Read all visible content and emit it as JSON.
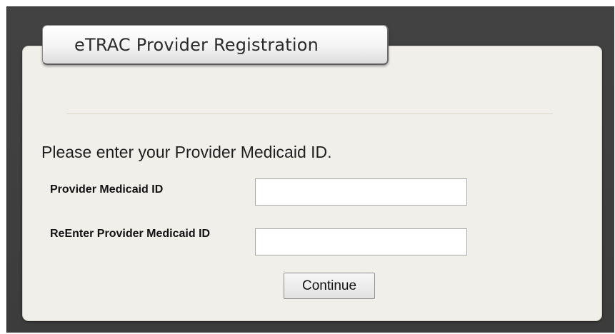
{
  "form": {
    "title": "eTRAC Provider Registration",
    "instruction": "Please enter your Provider Medicaid ID.",
    "fields": [
      {
        "label": "Provider Medicaid ID",
        "value": "",
        "placeholder": ""
      },
      {
        "label": "ReEnter Provider Medicaid ID",
        "value": "",
        "placeholder": ""
      }
    ],
    "continue_label": "Continue"
  },
  "colors": {
    "background": "#3e3e3e",
    "panel": "#f1efea",
    "title_tab": "#f4f4f4"
  }
}
